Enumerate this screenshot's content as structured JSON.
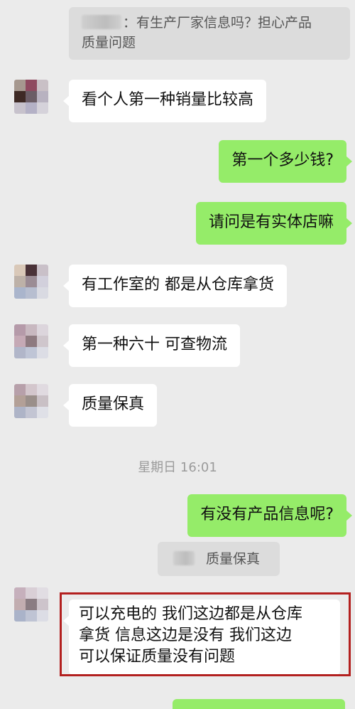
{
  "messages": {
    "quote1": {
      "text_line1": "：有生产厂家信息吗？担心产品",
      "text_line2": "质量问题"
    },
    "m1": "看个人第一种销量比较高",
    "m2": "第一个多少钱?",
    "m3": "请问是有实体店嘛",
    "m4": "有工作室的 都是从仓库拿货",
    "m5": "第一种六十 可查物流",
    "m6": "质量保真",
    "timestamp": "星期日 16:01",
    "m7": "有没有产品信息呢?",
    "quote2": "质量保真",
    "m8_line1": "可以充电的 我们这边都是从仓库",
    "m8_line2": "拿货 信息这边是没有 我们这边",
    "m8_line3": "可以保证质量没有问题"
  },
  "colors": {
    "background": "#ebebeb",
    "incoming_bubble": "#ffffff",
    "outgoing_bubble": "#95ec69",
    "quote_bubble": "#dcdcdc",
    "highlight_border": "#b3201f",
    "timestamp_text": "#9b9b9b"
  },
  "icons": {
    "avatar": "pixelated-avatar"
  }
}
